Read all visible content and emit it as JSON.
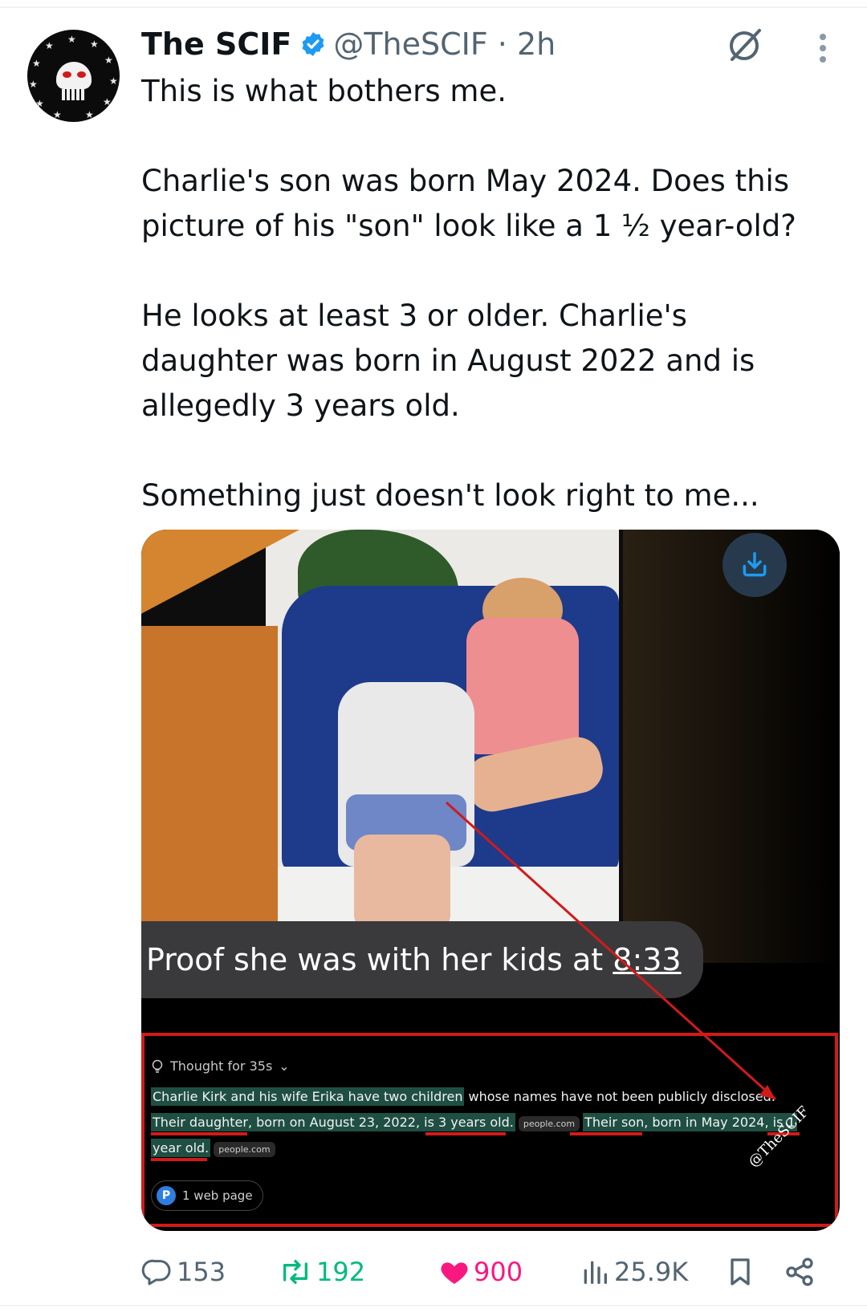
{
  "tweet": {
    "display_name": "The SCIF",
    "handle_time": "@TheSCIF · 2h",
    "paragraphs": [
      "This is what bothers me.",
      "Charlie's son was born May 2024. Does this picture of his \"son\" look like a 1 ½ year-old?",
      "He looks at least 3 or older. Charlie's daughter was born in August 2022 and is allegedly 3 years old.",
      "Something just doesn't look right to me..."
    ]
  },
  "media": {
    "bubble_text_main": "Proof she was with her kids at ",
    "bubble_text_time": "8:33",
    "thought_label": "Thought for 35s",
    "ai_line1_hl": "Charlie Kirk and his wife Erika have two children",
    "ai_line1_rest": " whose names have not been publicly disclosed.",
    "ai_line2_a": "Their daughter, born on August 23, 2022, is 3 years old.",
    "ai_line2_chip": "people.com",
    "ai_line2_b": "Their son, born in May 2024, is 1",
    "ai_line3": "year old.",
    "ai_line3_chip": "people.com",
    "web_chip_icon": "P",
    "web_chip": "1 web page",
    "watermark": "@TheSCIF"
  },
  "actions": {
    "replies": "153",
    "reposts": "192",
    "likes": "900",
    "views": "25.9K"
  },
  "colors": {
    "accent_blue": "#1d9bf0",
    "repost_green": "#00ba7c",
    "like_pink": "#f91880",
    "muted": "#536471",
    "annotation_red": "#d01b1b"
  }
}
